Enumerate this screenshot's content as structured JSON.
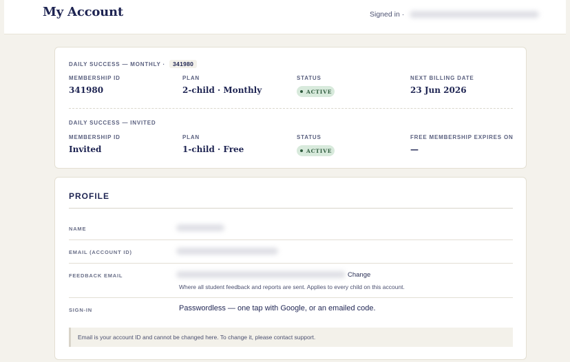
{
  "header": {
    "title": "My Account",
    "signed_in_label": "Signed in ·"
  },
  "memberships": [
    {
      "heading": "DAILY SUCCESS — MONTHLY ·",
      "heading_id": "341980",
      "fields": [
        {
          "label": "MEMBERSHIP ID",
          "value": "341980"
        },
        {
          "label": "PLAN",
          "value": "2-child · Monthly"
        },
        {
          "label": "STATUS",
          "badge": "ACTIVE"
        },
        {
          "label": "NEXT BILLING DATE",
          "value": "23 Jun 2026"
        }
      ]
    },
    {
      "heading": "DAILY SUCCESS — INVITED",
      "fields": [
        {
          "label": "MEMBERSHIP ID",
          "value": "Invited"
        },
        {
          "label": "PLAN",
          "value": "1-child · Free"
        },
        {
          "label": "STATUS",
          "badge": "ACTIVE"
        },
        {
          "label": "FREE MEMBERSHIP EXPIRES ON",
          "value": "—"
        }
      ]
    }
  ],
  "profile": {
    "title": "PROFILE",
    "name_label": "NAME",
    "email_label": "EMAIL (ACCOUNT ID)",
    "feedback_label": "FEEDBACK EMAIL",
    "change_label": "Change",
    "feedback_hint": "Where all student feedback and reports are sent. Applies to every child on this account.",
    "signin_label": "SIGN-IN",
    "signin_value": "Passwordless — one tap with Google, or an emailed code.",
    "note": "Email is your account ID and cannot be changed here. To change it, please contact support."
  },
  "colors": {
    "page_bg": "#f4f2ec",
    "accent_navy": "#1e2452",
    "badge_bg": "#d8eadc",
    "badge_text": "#2f5c3e"
  }
}
